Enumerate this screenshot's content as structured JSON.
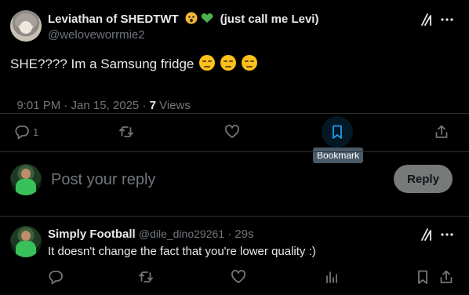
{
  "tweet": {
    "author_name": "Leviathan of SHEDTWT",
    "author_name_suffix": "(just call me Levi)",
    "author_handle": "@weloveworrmie2",
    "text": "SHE???? Im a Samsung fridge",
    "time": "9:01 PM · Jan 15, 2025 · ",
    "views_count": "7",
    "views_label": " Views",
    "reply_count": "1"
  },
  "tooltip": {
    "bookmark": "Bookmark"
  },
  "compose": {
    "placeholder": "Post your reply",
    "reply_label": "Reply"
  },
  "reply_tweet": {
    "author_name": "Simply Football",
    "author_handle": "@dile_dino29261",
    "separator": " · ",
    "time": "29s",
    "text": "It doesn't change the fact that you're lower quality :)"
  },
  "colors": {
    "accent": "#1d9bf0",
    "background": "#000000",
    "muted": "#71767b",
    "text": "#e7e9ea"
  }
}
